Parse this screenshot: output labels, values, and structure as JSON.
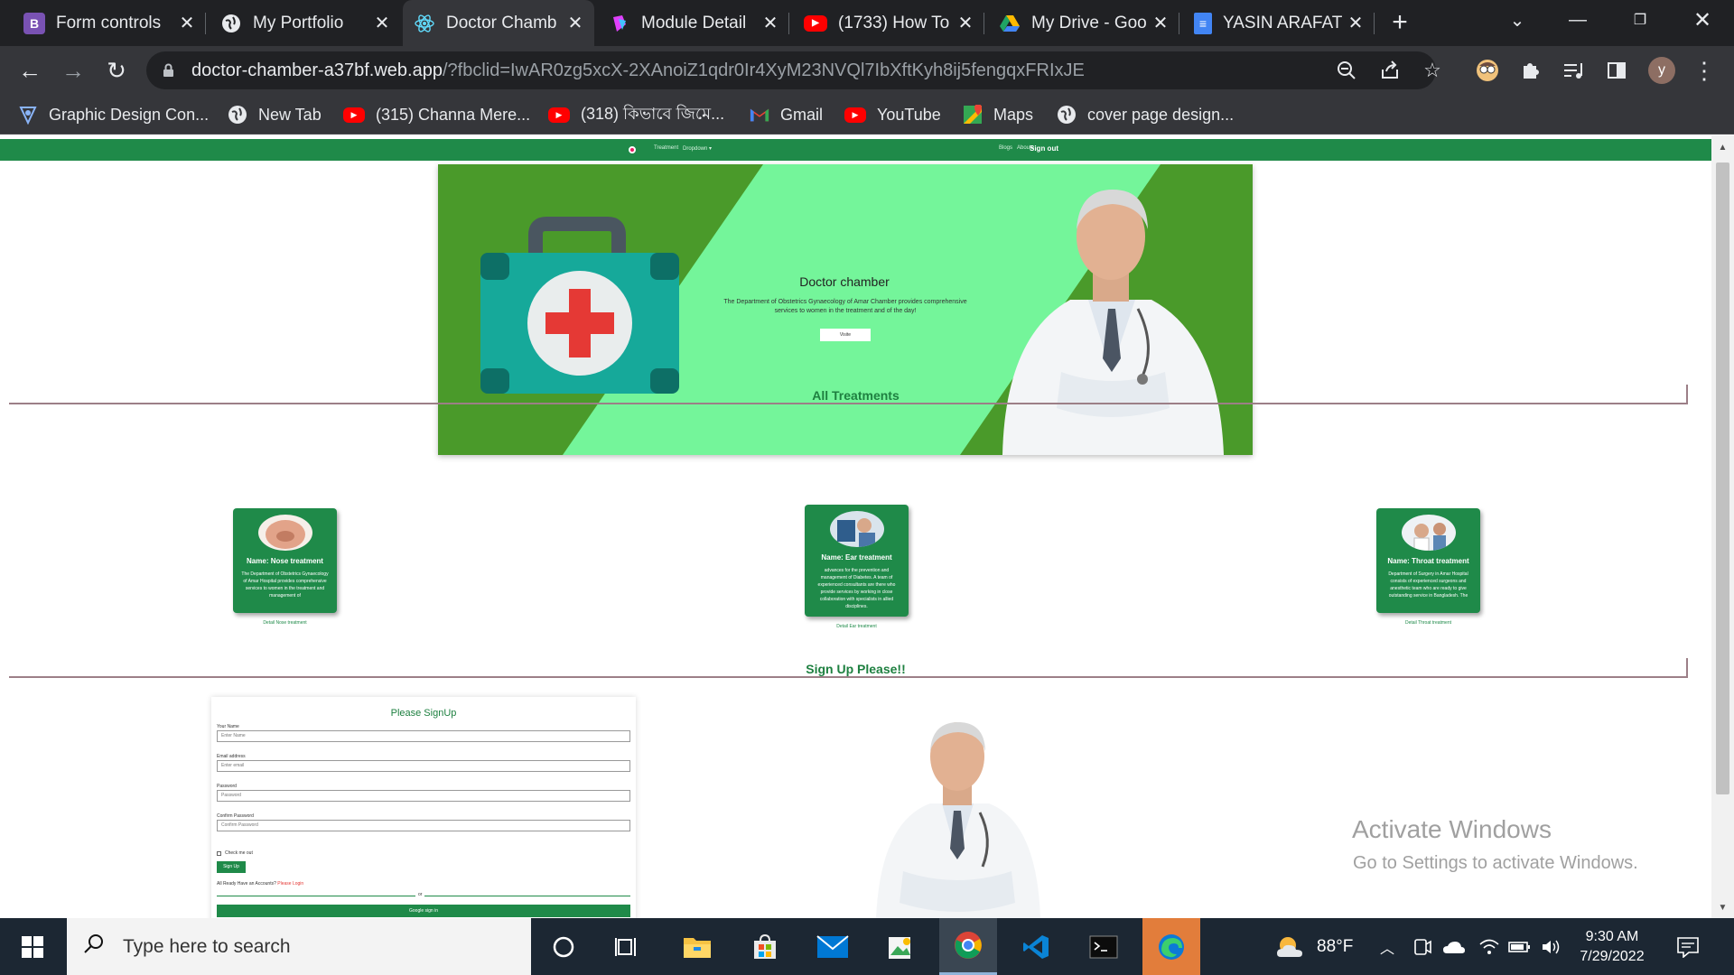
{
  "browser": {
    "tabs": [
      {
        "title": "Form controls",
        "icon": "bootstrap-icon",
        "color": "#7952b3",
        "glyph": "B"
      },
      {
        "title": "My Portfolio",
        "icon": "globe-icon",
        "color": "#5f6368",
        "glyph": ""
      },
      {
        "title": "Doctor Chamb",
        "icon": "react-icon",
        "color": "#35363a",
        "glyph": "",
        "active": true
      },
      {
        "title": "Module Detail",
        "icon": "module-icon",
        "color": "#e040fb",
        "glyph": ""
      },
      {
        "title": "(1733) How To",
        "icon": "youtube-icon",
        "color": "#ff0000",
        "glyph": "▶"
      },
      {
        "title": "My Drive - Goo",
        "icon": "drive-icon",
        "color": "#1fa463",
        "glyph": ""
      },
      {
        "title": "YASIN ARAFAT",
        "icon": "docs-icon",
        "color": "#4285f4",
        "glyph": "≡"
      }
    ],
    "url_host": "doctor-chamber-a37bf.web.app",
    "url_path": "/?fbclid=IwAR0zg5xcX-2XAnoiZ1qdr0Ir4XyM23NVQl7IbXftKyh8ij5fengqxFRIxJE",
    "profile_initial": "y",
    "bookmarks": [
      {
        "label": "Graphic Design Con...",
        "icon": "design-icon"
      },
      {
        "label": "New Tab",
        "icon": "globe-icon"
      },
      {
        "label": "(315) Channa Mere...",
        "icon": "youtube-icon"
      },
      {
        "label": "(318) কিভাবে জিমে...",
        "icon": "youtube-icon"
      },
      {
        "label": "Gmail",
        "icon": "gmail-icon"
      },
      {
        "label": "YouTube",
        "icon": "youtube-icon"
      },
      {
        "label": "Maps",
        "icon": "maps-icon"
      },
      {
        "label": "cover page design...",
        "icon": "globe-icon"
      }
    ]
  },
  "site": {
    "nav": {
      "left": [
        "Treatment",
        "Dropdown ▾"
      ],
      "right": [
        "Blogs",
        "Aboute"
      ],
      "signout": "Sign out"
    },
    "hero": {
      "title": "Doctor chamber",
      "text": "The Department of Obstetrics Gynaecology of Amar Chamber provides comprehensive services to women in the treatment and of the day!",
      "button": "Visite"
    },
    "treatments_title": "All Treatments",
    "treatments": [
      {
        "name": "Name: Nose treatment",
        "desc": "The Department of Obstetrics Gynaecology of Amar Hospital provides comprehensive services to women in the treatment and management of",
        "button": "Detail Nose treatment"
      },
      {
        "name": "Name: Ear treatment",
        "desc": "advances for the prevention and management of Diabetes. A team of experienced consultants are there who provide services by working in close collaboration with specialists in allied disciplines.",
        "button": "Detail Ear treatment"
      },
      {
        "name": "Name: Throat treatment",
        "desc": "Department of Surgery in Amar Hospital consists of experienced surgeons and anesthetic team who are ready to give outstanding service in Bangladesh. The",
        "button": "Detail Throat treatment"
      }
    ],
    "signup_section_title": "Sign Up Please!!",
    "signup": {
      "title": "Please SignUp",
      "fields": [
        {
          "label": "Your Name",
          "placeholder": "Enter Name"
        },
        {
          "label": "Email address",
          "placeholder": "Enter email"
        },
        {
          "label": "Password",
          "placeholder": "Password"
        },
        {
          "label": "Confirm Password",
          "placeholder": "Confirm Password"
        }
      ],
      "checkbox": "Check me out",
      "button": "Sign Up",
      "already": "All Ready Have an Accounts?",
      "login_link": "Please Login",
      "or": "or",
      "google": "Google sign in"
    },
    "watermark_title": "Activate Windows",
    "watermark_sub": "Go to Settings to activate Windows."
  },
  "taskbar": {
    "search_placeholder": "Type here to search",
    "weather": "88°F",
    "time": "9:30 AM",
    "date": "7/29/2022"
  },
  "colors": {
    "site_green": "#1f8a49",
    "hero_dark": "#4a9a2a",
    "hero_light": "#74f59a"
  }
}
